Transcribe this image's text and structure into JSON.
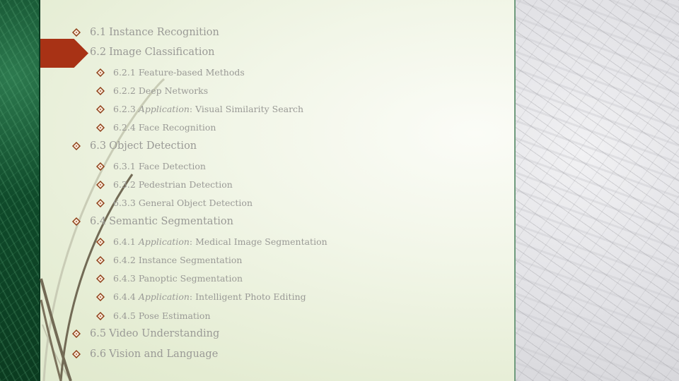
{
  "slide": {
    "accent_color": "#a83215",
    "bullet_color": "#8b3a12",
    "text_color": "#9a9a96",
    "outline": [
      {
        "level": 1,
        "number": "6.1",
        "title": "Instance Recognition"
      },
      {
        "level": 1,
        "number": "6.2",
        "title": "Image Classification",
        "current": true
      },
      {
        "level": 2,
        "number": "6.2.1",
        "title": "Feature-based Methods"
      },
      {
        "level": 2,
        "number": "6.2.2",
        "title": "Deep Networks"
      },
      {
        "level": 2,
        "number": "6.2.3",
        "prefix": "Application",
        "title": ": Visual Similarity Search"
      },
      {
        "level": 2,
        "number": "6.2.4",
        "title": "Face Recognition"
      },
      {
        "level": 1,
        "number": "6.3",
        "title": "Object Detection"
      },
      {
        "level": 2,
        "number": "6.3.1",
        "title": "Face Detection"
      },
      {
        "level": 2,
        "number": "6.3.2",
        "title": "Pedestrian Detection"
      },
      {
        "level": 2,
        "number": "6.3.3",
        "title": "General Object Detection"
      },
      {
        "level": 1,
        "number": "6.4",
        "title": "Semantic Segmentation"
      },
      {
        "level": 2,
        "number": "6.4.1",
        "prefix": "Application",
        "title": ": Medical Image Segmentation"
      },
      {
        "level": 2,
        "number": "6.4.2",
        "title": "Instance Segmentation"
      },
      {
        "level": 2,
        "number": "6.4.3",
        "title": "Panoptic Segmentation"
      },
      {
        "level": 2,
        "number": "6.4.4",
        "prefix": "Application",
        "title": ": Intelligent Photo Editing"
      },
      {
        "level": 2,
        "number": "6.4.5",
        "title": "Pose Estimation"
      },
      {
        "level": 1,
        "number": "6.5",
        "title": "Video Understanding"
      },
      {
        "level": 1,
        "number": "6.6",
        "title": "Vision and Language"
      }
    ]
  }
}
